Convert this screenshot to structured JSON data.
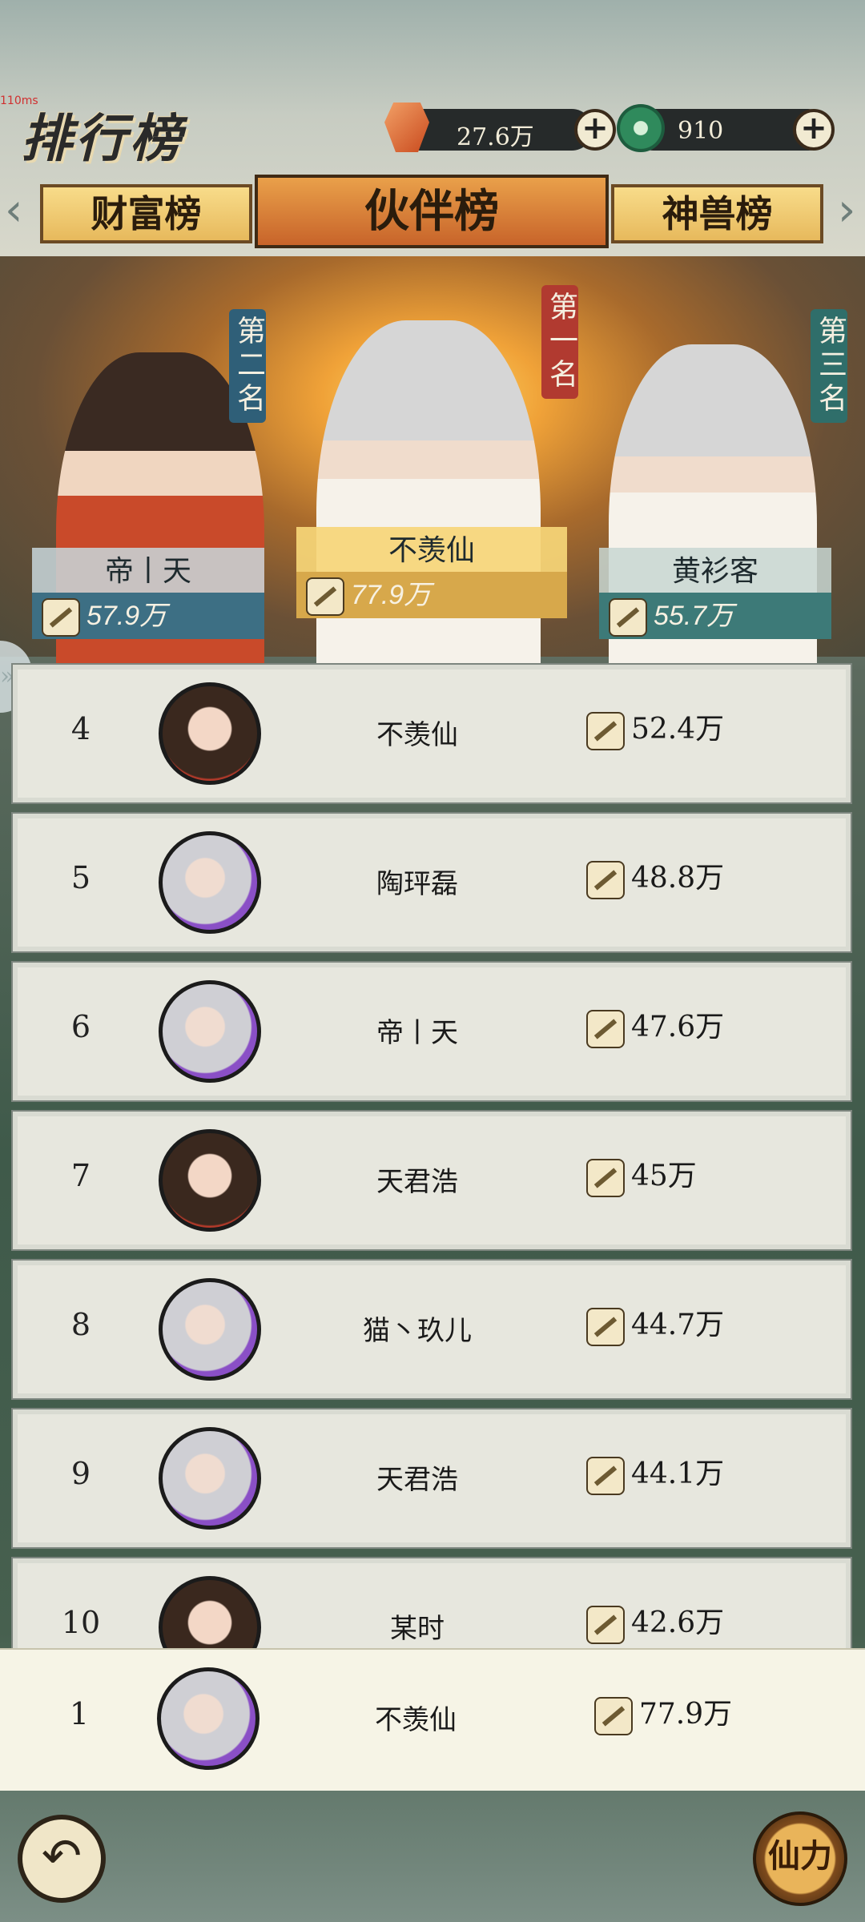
{
  "debug": "110ms",
  "page_title": "排行榜",
  "currency": {
    "gem": "27.6万",
    "jade": "910",
    "plus": "+"
  },
  "tabs": [
    "财富榜",
    "伙伴榜",
    "神兽榜"
  ],
  "podium": [
    {
      "rank_label": "第二名",
      "name": "帝丨天",
      "power": "57.9万"
    },
    {
      "rank_label": "第一名",
      "name": "不羡仙",
      "power": "77.9万"
    },
    {
      "rank_label": "第三名",
      "name": "黄衫客",
      "power": "55.7万"
    }
  ],
  "rows": [
    {
      "rank": "4",
      "name": "不羡仙",
      "power": "52.4万",
      "avatar": "red"
    },
    {
      "rank": "5",
      "name": "陶玶磊",
      "power": "48.8万",
      "avatar": "silver"
    },
    {
      "rank": "6",
      "name": "帝丨天",
      "power": "47.6万",
      "avatar": "silver"
    },
    {
      "rank": "7",
      "name": "天君浩",
      "power": "45万",
      "avatar": "red"
    },
    {
      "rank": "8",
      "name": "猫丶玖儿",
      "power": "44.7万",
      "avatar": "silver"
    },
    {
      "rank": "9",
      "name": "天君浩",
      "power": "44.1万",
      "avatar": "silver"
    },
    {
      "rank": "10",
      "name": "某时",
      "power": "42.6万",
      "avatar": "red"
    }
  ],
  "my_rank": {
    "rank": "1",
    "name": "不羡仙",
    "power": "77.9万"
  },
  "back_icon": "↶",
  "power_button": "仙力"
}
